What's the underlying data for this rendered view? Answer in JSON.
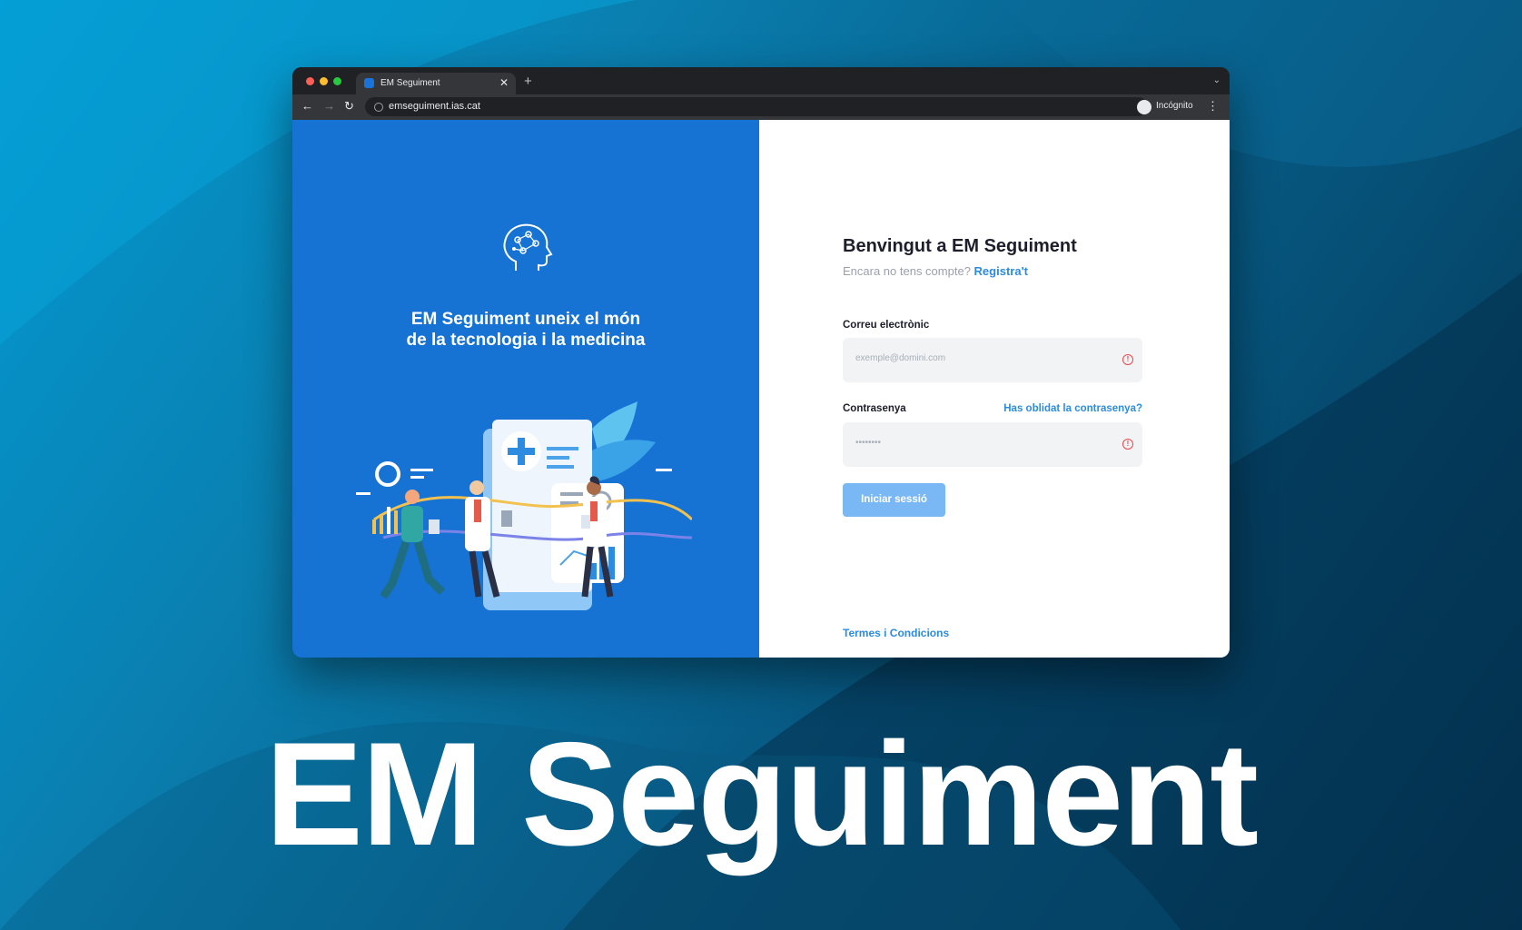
{
  "browser": {
    "tab_title": "EM Seguiment",
    "tab_close": "✕",
    "new_tab": "+",
    "tab_menu": "⌄",
    "url": "emseguiment.ias.cat",
    "incognito_label": "Incógnito",
    "back": "←",
    "forward": "→",
    "reload": "↻",
    "menu": "⋮"
  },
  "left_panel": {
    "tagline_line1": "EM Seguiment uneix el món",
    "tagline_line2": "de la tecnologia i la medicina",
    "background_color": "#1673d4"
  },
  "login": {
    "title": "Benvingut a EM Seguiment",
    "signup_prompt": "Encara no tens compte?",
    "signup_link": "Registra't",
    "email_label": "Correu electrònic",
    "email_placeholder": "exemple@domini.com",
    "password_label": "Contrasenya",
    "password_placeholder": "••••••••",
    "forgot_link": "Has oblidat la contrasenya?",
    "submit_label": "Iniciar sessió",
    "terms_link": "Termes i Condicions",
    "accent_color": "#2d8be0",
    "error_icon": "alert-circle-icon"
  },
  "hero": {
    "title": "EM Seguiment"
  }
}
